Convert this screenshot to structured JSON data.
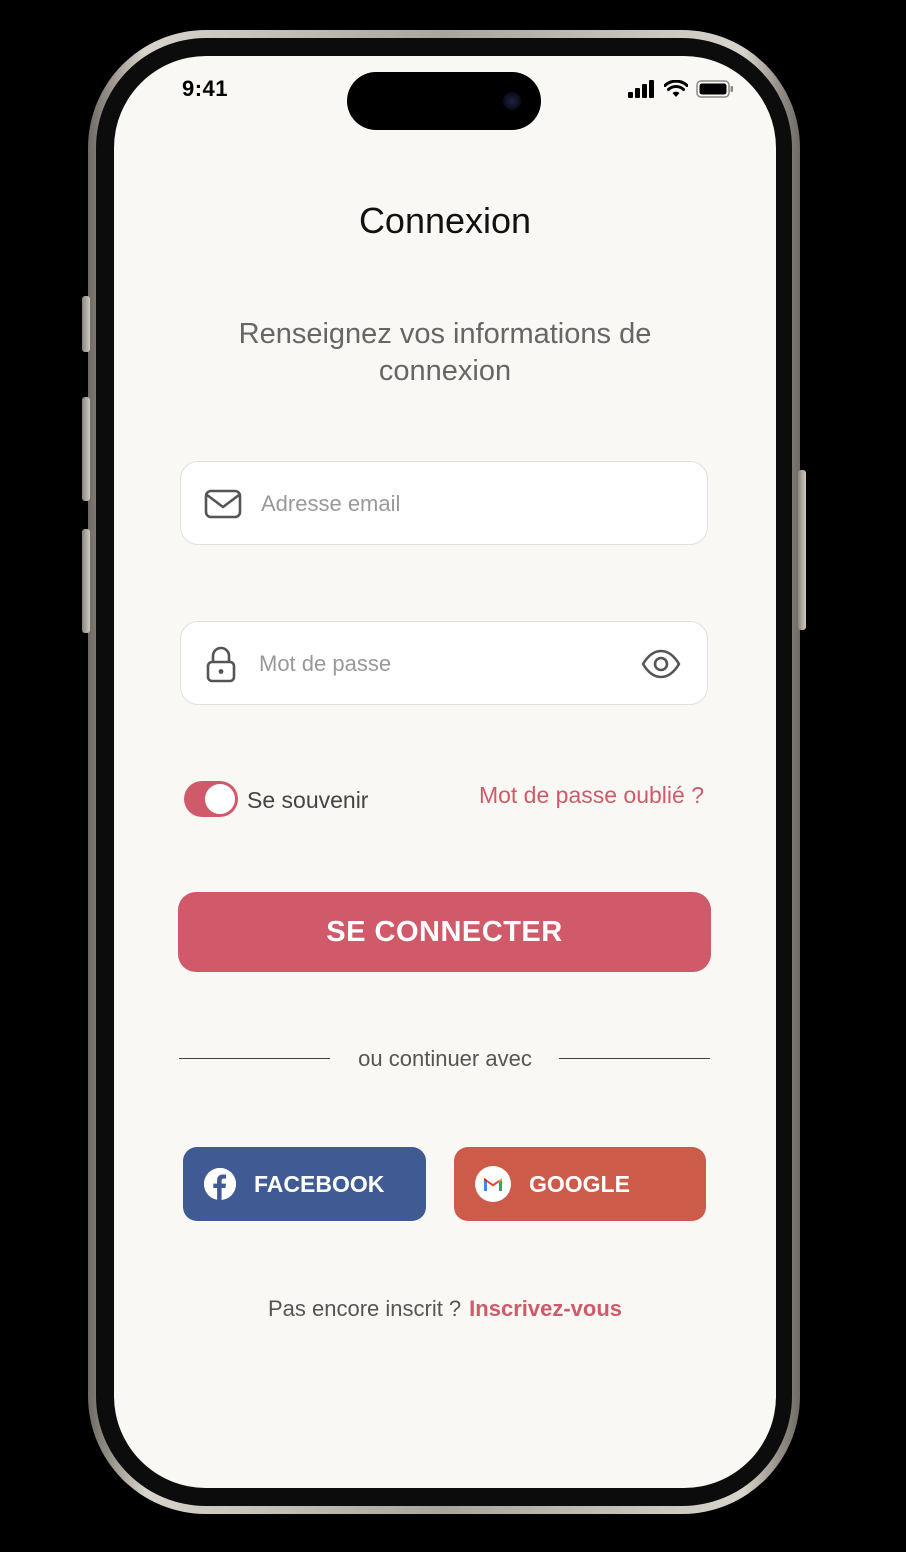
{
  "status_bar": {
    "time": "9:41"
  },
  "header": {
    "title": "Connexion",
    "subtitle": "Renseignez vos informations de connexion"
  },
  "form": {
    "email": {
      "placeholder": "Adresse email",
      "value": "",
      "icon": "mail-icon"
    },
    "password": {
      "placeholder": "Mot de passe",
      "value": "",
      "icon": "lock-icon",
      "visibility_icon": "eye-icon"
    },
    "remember": {
      "label": "Se souvenir",
      "enabled": true
    },
    "forgot_password": "Mot de passe oublié ?",
    "submit_label": "SE CONNECTER"
  },
  "social": {
    "divider_text": "ou continuer avec",
    "facebook_label": "FACEBOOK",
    "google_label": "GOOGLE"
  },
  "footer": {
    "prompt": "Pas encore inscrit ?",
    "signup_link": "Inscrivez-vous"
  },
  "colors": {
    "accent": "#d05a6a",
    "facebook": "#405a93",
    "google": "#cd5b4a",
    "background": "#f9f8f4"
  }
}
